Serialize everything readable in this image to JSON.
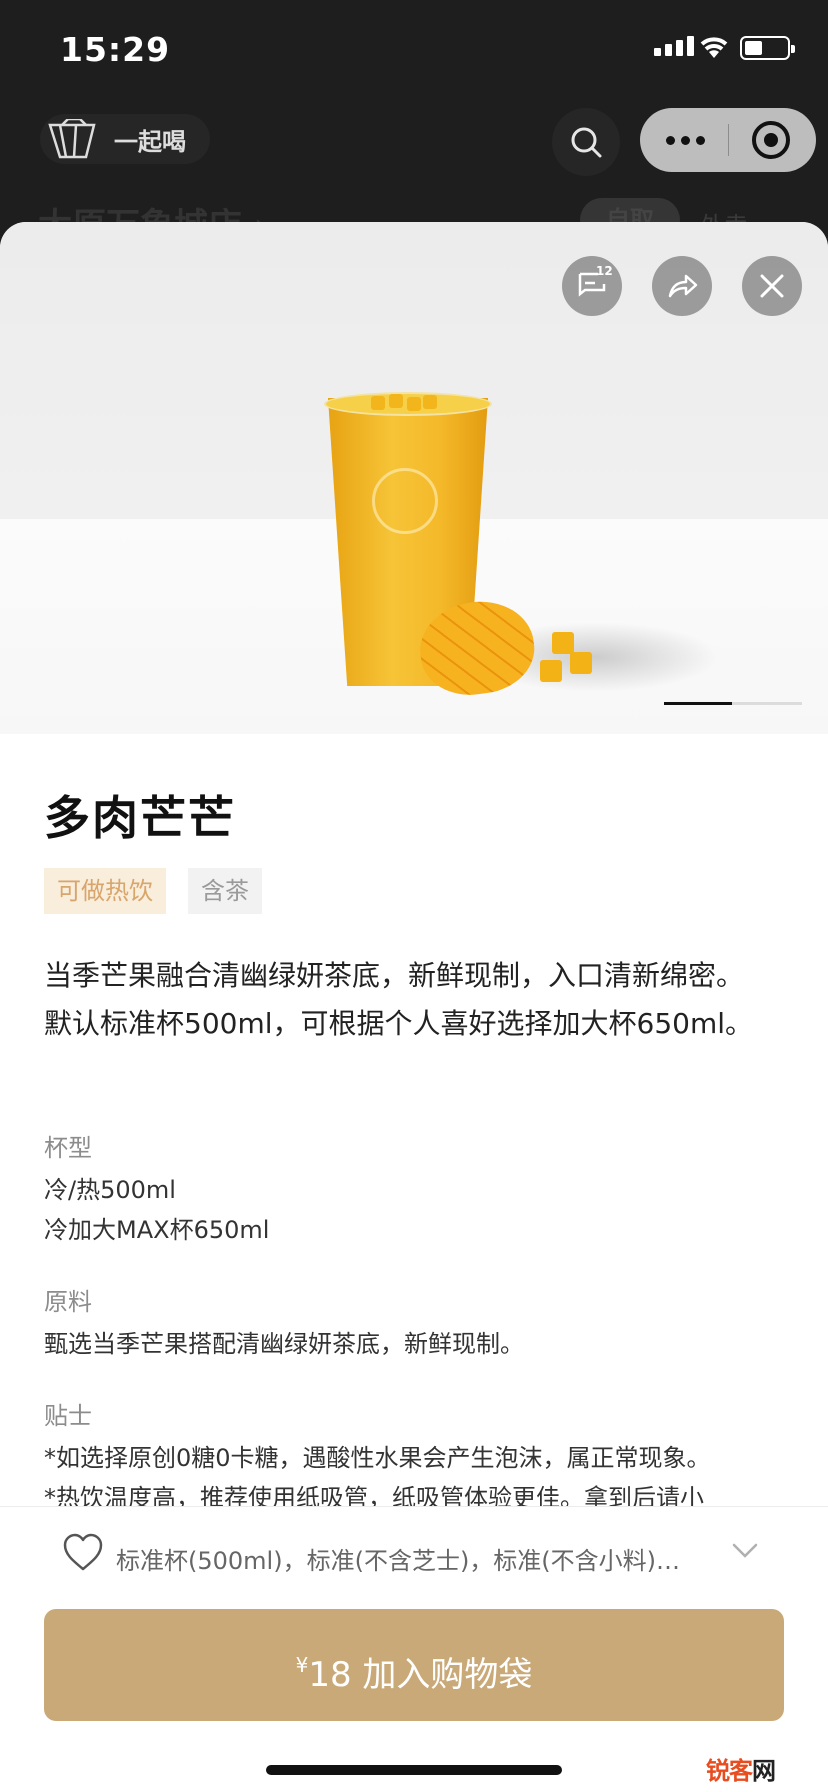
{
  "status_bar": {
    "time": "15:29"
  },
  "top_nav": {
    "brand_label": "一起喝",
    "store_name": "太原万象城店 ›",
    "mode_active": "自取",
    "mode_inactive": "外卖"
  },
  "hero": {
    "comment_count": "12",
    "pager": {
      "current": 1,
      "total": 2
    }
  },
  "product": {
    "name": "多肉芒芒",
    "tags": [
      "可做热饮",
      "含茶"
    ],
    "description": "当季芒果融合清幽绿妍茶底，新鲜现制，入口清新绵密。默认标准杯500ml，可根据个人喜好选择加大杯650ml。",
    "cup_label": "杯型",
    "cup_options": [
      "冷/热500ml",
      "冷加大MAX杯650ml"
    ],
    "ingredients_label": "原料",
    "ingredients": "甄选当季芒果搭配清幽绿妍茶底，新鲜现制。",
    "tips_label": "贴士",
    "tips": [
      "*如选择原创0糖0卡糖，遇酸性水果会产生泡沫，属正常现象。",
      "*热饮温度高，推荐使用纸吸管，纸吸管体验更佳。拿到后请小"
    ]
  },
  "bottom_bar": {
    "selected_specs": "标准杯(500ml)，标准(不含芝士)，标准(不含小料)…",
    "price_symbol": "¥",
    "price": "18",
    "add_label": "加入购物袋"
  },
  "watermark": {
    "part1": "锐客",
    "part2": "网"
  },
  "colors": {
    "accent": "#c9a978",
    "tag_hot_bg": "#f9eddc",
    "tag_hot_text": "#d8a56b"
  }
}
